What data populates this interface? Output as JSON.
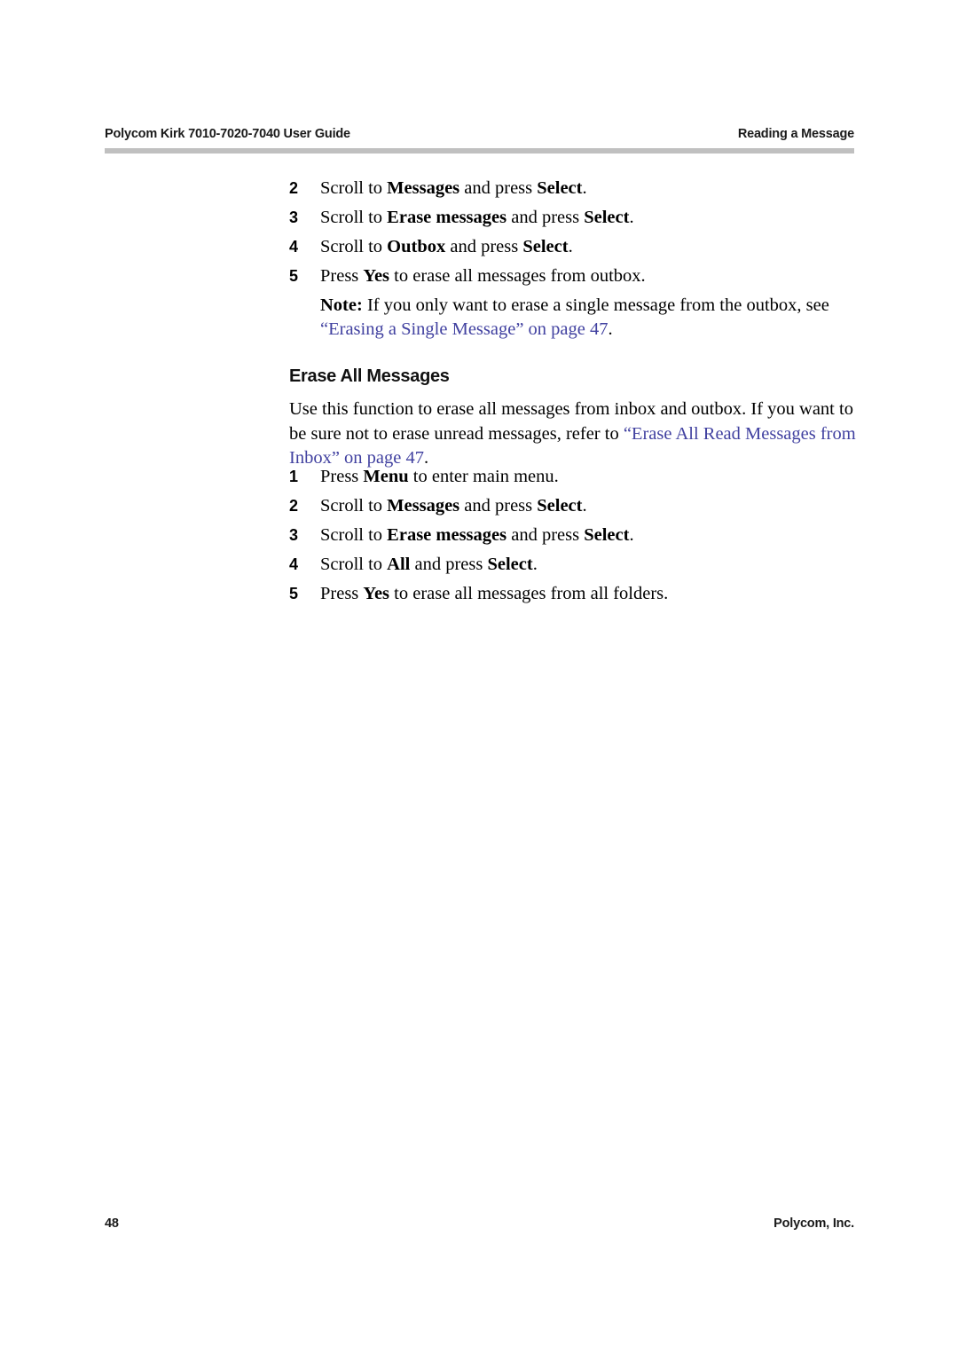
{
  "header": {
    "left": "Polycom Kirk 7010-7020-7040 User Guide",
    "right": "Reading a Message",
    "rule_color": "#c0c0c0"
  },
  "colors": {
    "text": "#000000",
    "cross_reference": "#4141a0"
  },
  "steps_outbox": [
    {
      "number": "2",
      "parts": [
        {
          "text": "Scroll to ",
          "bold": false
        },
        {
          "text": "Messages",
          "bold": true
        },
        {
          "text": " and press ",
          "bold": false
        },
        {
          "text": "Select",
          "bold": true
        },
        {
          "text": ".",
          "bold": false
        }
      ]
    },
    {
      "number": "3",
      "parts": [
        {
          "text": "Scroll to ",
          "bold": false
        },
        {
          "text": "Erase messages",
          "bold": true
        },
        {
          "text": " and press ",
          "bold": false
        },
        {
          "text": "Select",
          "bold": true
        },
        {
          "text": ".",
          "bold": false
        }
      ]
    },
    {
      "number": "4",
      "parts": [
        {
          "text": "Scroll to ",
          "bold": false
        },
        {
          "text": "Outbox",
          "bold": true
        },
        {
          "text": " and press ",
          "bold": false
        },
        {
          "text": "Select",
          "bold": true
        },
        {
          "text": ".",
          "bold": false
        }
      ]
    },
    {
      "number": "5",
      "parts": [
        {
          "text": "Press ",
          "bold": false
        },
        {
          "text": "Yes",
          "bold": true
        },
        {
          "text": " to erase all messages from outbox.",
          "bold": false
        }
      ]
    }
  ],
  "note": {
    "label": "Note:",
    "body_before": " If you only want to erase a single message from the outbox, see ",
    "xref": "“Erasing a Single Message” on page 47",
    "body_after": "."
  },
  "section": {
    "title": "Erase All Messages",
    "paragraph_before": "Use this function to erase all messages from inbox and outbox. If you want to be sure not to erase unread messages, refer to ",
    "paragraph_xref": "“Erase All Read Messages from Inbox” on page 47",
    "paragraph_after": "."
  },
  "steps_all": [
    {
      "number": "1",
      "parts": [
        {
          "text": "Press ",
          "bold": false
        },
        {
          "text": "Menu",
          "bold": true
        },
        {
          "text": " to enter main menu.",
          "bold": false
        }
      ]
    },
    {
      "number": "2",
      "parts": [
        {
          "text": "Scroll to ",
          "bold": false
        },
        {
          "text": "Messages",
          "bold": true
        },
        {
          "text": " and press ",
          "bold": false
        },
        {
          "text": "Select",
          "bold": true
        },
        {
          "text": ".",
          "bold": false
        }
      ]
    },
    {
      "number": "3",
      "parts": [
        {
          "text": "Scroll to ",
          "bold": false
        },
        {
          "text": "Erase messages",
          "bold": true
        },
        {
          "text": " and press ",
          "bold": false
        },
        {
          "text": "Select",
          "bold": true
        },
        {
          "text": ".",
          "bold": false
        }
      ]
    },
    {
      "number": "4",
      "parts": [
        {
          "text": "Scroll to ",
          "bold": false
        },
        {
          "text": "All",
          "bold": true
        },
        {
          "text": " and press ",
          "bold": false
        },
        {
          "text": "Select",
          "bold": true
        },
        {
          "text": ".",
          "bold": false
        }
      ]
    },
    {
      "number": "5",
      "parts": [
        {
          "text": "Press ",
          "bold": false
        },
        {
          "text": "Yes",
          "bold": true
        },
        {
          "text": " to erase all messages from all folders.",
          "bold": false
        }
      ]
    }
  ],
  "footer": {
    "page_number": "48",
    "company": "Polycom, Inc."
  }
}
